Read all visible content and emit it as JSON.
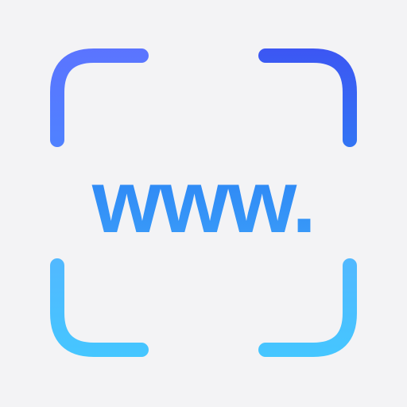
{
  "app_icon": {
    "name": "web-address-scanner-icon",
    "text": "www.",
    "background_color": "#f3f3f5",
    "colors": {
      "top_left": "#6d83ff",
      "top_right": "#3b57f2",
      "middle": "#2d8ff7",
      "bottom": "#46c8ff"
    }
  }
}
